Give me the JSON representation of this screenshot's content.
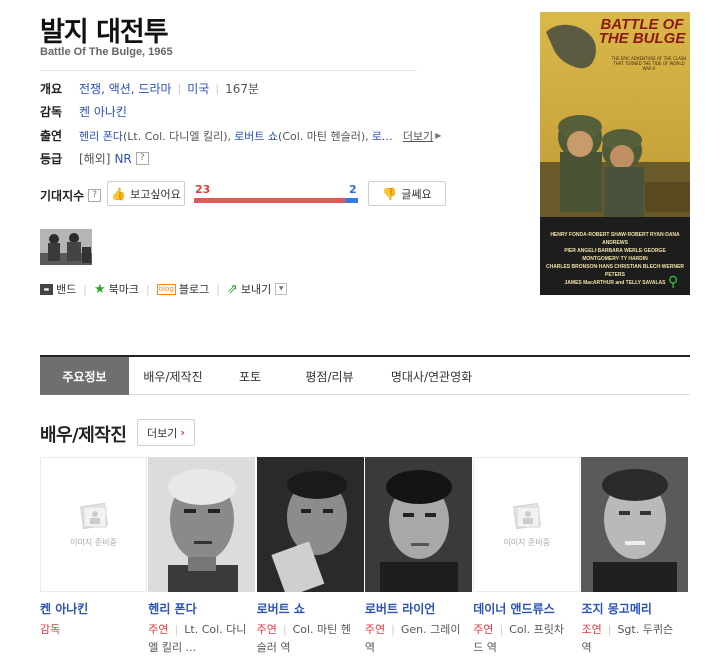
{
  "movie": {
    "title": "발지 대전투",
    "original_title": "Battle Of The Bulge, 1965"
  },
  "info": {
    "overview_label": "개요",
    "genres": "전쟁, 액션, 드라마",
    "country": "미국",
    "runtime": "167분",
    "director_label": "감독",
    "director": "켄 아나킨",
    "cast_label": "출연",
    "cast_1": "헨리 폰다",
    "cast_1_role": "(Lt. Col. 다니엘 킬리),",
    "cast_2": "로버트 쇼",
    "cast_2_role": "(Col. 마틴 헨슬러),",
    "cast_more_ellipsis": "로…",
    "more_label": "더보기",
    "rating_label": "등급",
    "rating_region": "[해외]",
    "rating": "NR"
  },
  "expectation": {
    "label": "기대지수",
    "want_label": "보고싶어요",
    "want_count": "23",
    "no_label": "글쎄요",
    "no_count": "2",
    "want_ratio": 0.92
  },
  "share": {
    "band": "밴드",
    "bookmark": "북마크",
    "blog": "블로그",
    "send": "보내기"
  },
  "poster": {
    "headline": "BATTLE OF THE BULGE",
    "tagline": "THE EPIC ADVENTURE OF THE CLASH THAT TURNED THE TIDE OF WORLD WAR II",
    "credits_1": "HENRY FONDA·ROBERT SHAW·ROBERT RYAN·DANA ANDREWS",
    "credits_2": "PIER ANGELI·BARBARA WERLE·GEORGE MONTGOMERY·TY HARDIN",
    "credits_3": "CHARLES BRONSON·HANS CHRISTIAN BLECH·WERNER PETERS",
    "credits_4": "JAMES MacARTHUR and TELLY SAVALAS"
  },
  "tabs": [
    {
      "label": "주요정보"
    },
    {
      "label": "배우/제작진"
    },
    {
      "label": "포토"
    },
    {
      "label": "평점/리뷰"
    },
    {
      "label": "명대사/연관영화"
    }
  ],
  "section": {
    "title": "배우/제작진",
    "more_label": "더보기"
  },
  "no_image_text": "이미지 준비중",
  "cast": [
    {
      "name": "켄 아나킨",
      "type": "감독",
      "role": ""
    },
    {
      "name": "헨리 폰다",
      "type": "주연",
      "role": "Lt. Col. 다니엘 킬리 ..."
    },
    {
      "name": "로버트 쇼",
      "type": "주연",
      "role": "Col. 마틴 헨슬러 역"
    },
    {
      "name": "로버트 라이언",
      "type": "주연",
      "role": "Gen. 그레이 역"
    },
    {
      "name": "데이너 앤드류스",
      "type": "주연",
      "role": "Col. 프릿차드 역"
    },
    {
      "name": "조지 몽고메리",
      "type": "조연",
      "role": "Sgt. 두퀴슨 역"
    }
  ],
  "colors": {
    "link": "#2b52b5",
    "accent_red": "#e0393f",
    "accent_blue": "#2f6fd3",
    "tab_active": "#6f6f6f"
  }
}
